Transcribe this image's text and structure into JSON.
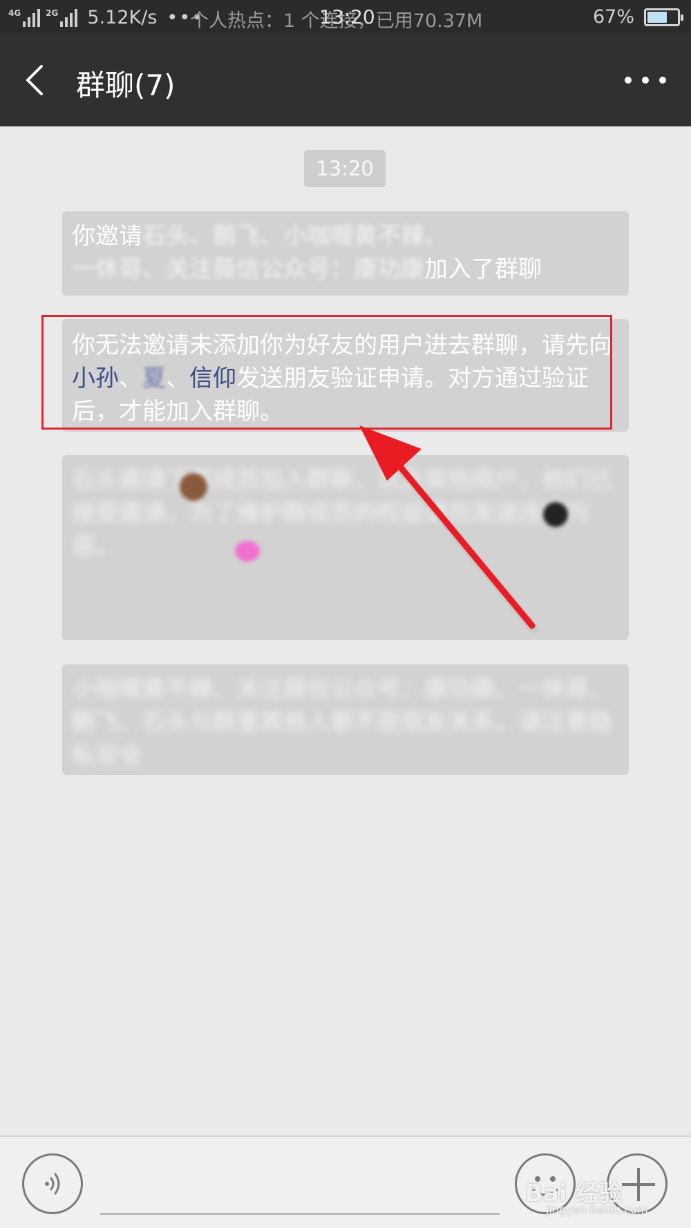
{
  "status_bar": {
    "net1": "4G",
    "net2": "4G",
    "net3": "2G",
    "speed": "5.12K/s",
    "dots": "•••",
    "notice": "个人热点：1 个连接，已用70.37M",
    "time": "13:20",
    "battery_percent_text": "67%",
    "battery_level": 0.67
  },
  "header": {
    "title": "群聊(7)"
  },
  "chat": {
    "time_label": "13:20",
    "msg1": {
      "prefix": "你邀请",
      "blurred": "石头、鹏飞、小咖喱黄不辣、",
      "line2_blurred": "一休哥、关注薇信公众号：康功康",
      "suffix": "加入了群聊"
    },
    "msg2": {
      "part1": "你无法邀请未添加你为好友的用户进去群聊，请先向",
      "name1": "小孙",
      "sep1": "、",
      "name2": "夏",
      "sep2": "、",
      "name3": "信仰",
      "part2": "发送朋友验证申请。对方通过验证后，才能加入群聊。"
    },
    "msg3": {
      "text": "石头邀请了群成员加入群聊，以及其他用户，他们已接受邀请，为了维护群成员的权益请勿发送违规内容。"
    },
    "msg4": {
      "text": "小咖喱黄不辣、关注薇信公众号：康功康、一休哥、鹏飞、石头与群里其他人都不是朋友关系，请注意隐私安全"
    }
  },
  "watermark": {
    "brand": "Bai 经验",
    "url": "jingyan.baidu.com"
  },
  "colors": {
    "status_bar": "#2b2b2b",
    "title_bar": "#303030",
    "chat_bg": "#eaeaea",
    "highlight": "#e0272f",
    "link": "#3b4e86"
  }
}
